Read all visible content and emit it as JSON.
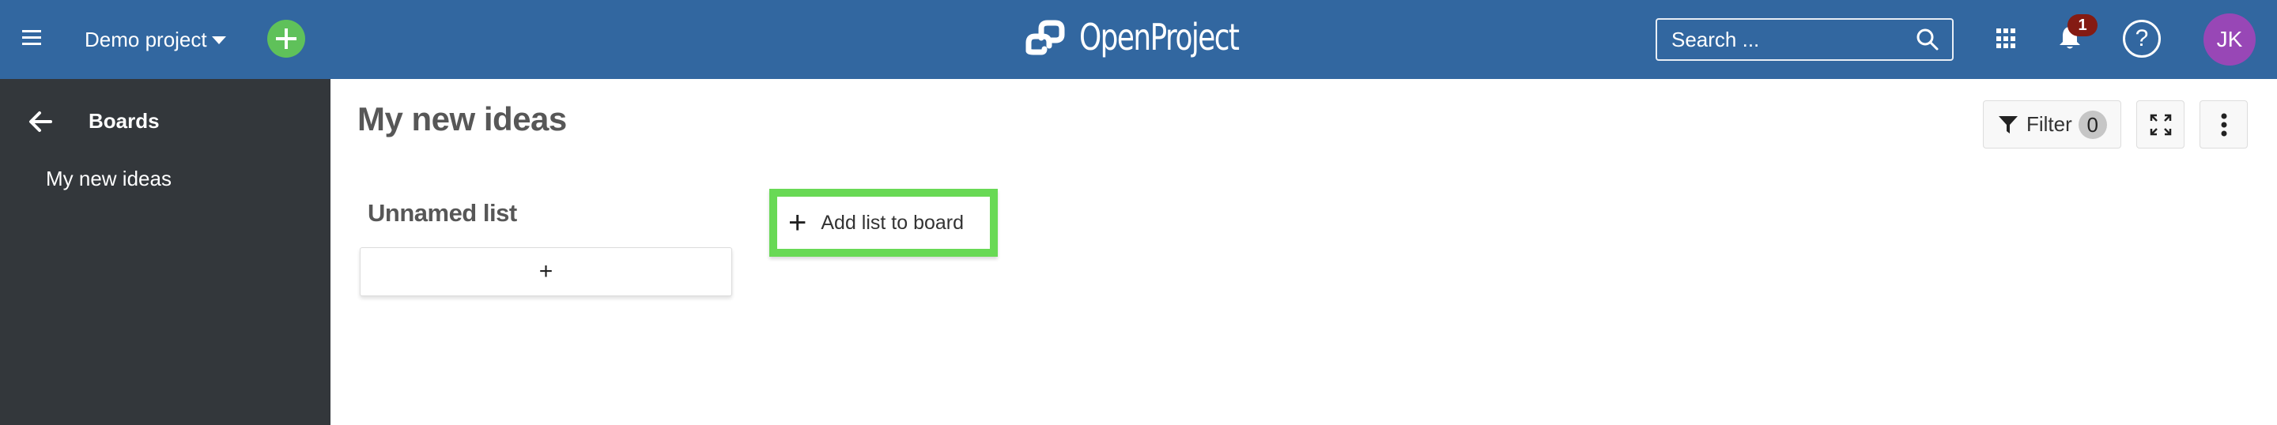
{
  "header": {
    "project_name": "Demo project",
    "logo_text": "OpenProject",
    "search_placeholder": "Search ...",
    "notification_count": "1",
    "help_label": "?",
    "avatar_initials": "JK",
    "colors": {
      "header_bg": "#3267a0",
      "add_button": "#5fc15a",
      "badge": "#841b13",
      "avatar": "#9847b6"
    }
  },
  "sidebar": {
    "title": "Boards",
    "items": [
      {
        "label": "My new ideas"
      }
    ]
  },
  "main": {
    "title": "My new ideas",
    "toolbar": {
      "filter_label": "Filter",
      "filter_count": "0"
    },
    "lists": [
      {
        "title": "Unnamed list",
        "add_card_label": "+"
      }
    ],
    "add_list_label": "Add list to board",
    "add_list_icon": "+",
    "highlight_color": "#68d955"
  }
}
